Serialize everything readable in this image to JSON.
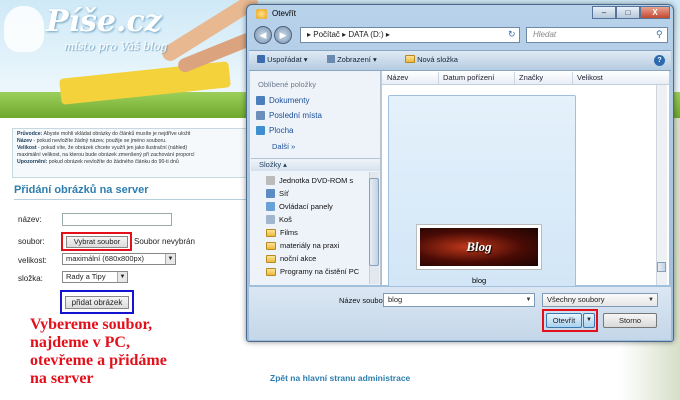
{
  "site": {
    "logo_text": "Píše.cz",
    "tagline": "místo pro Váš blog",
    "info_lines": [
      {
        "bold": "Průvodce:",
        "text": " Abyste mohli vkládat obrázky do článků musíte je nejdříve uložit"
      },
      {
        "bold": "Název",
        "text": " - pokud nevložíte žádný název, použije se jméno souboru."
      },
      {
        "bold": "Velikost",
        "text": " - pokud víte, že obrázek chcete využít jen jako ilustrační (náhled)"
      },
      {
        "bold": "",
        "text": "maximální velikost, na kterou bude obrázek zmenšený při zachování proporcí"
      },
      {
        "bold": "Upozornění:",
        "text": " pokud obrázek nevložíte do žádného článku do 90-ti dnů"
      }
    ],
    "section_title": "Přidání obrázků na server",
    "form": {
      "nazev_label": "název:",
      "nazev_value": "",
      "soubor_label": "soubor:",
      "pick_button": "Vybrat soubor",
      "no_file_text": "Soubor nevybrán",
      "velikost_label": "velikost:",
      "velikost_value": "maximální (680x800px)",
      "slozka_label": "složka:",
      "slozka_value": "Rady a Tipy",
      "submit_button": "přidat obrázek"
    },
    "annotation_lines": [
      "Vybereme soubor,",
      "najdeme v PC,",
      "otevřeme a přidáme",
      "na server"
    ],
    "back_link": "Zpět na hlavní stranu administrace"
  },
  "dialog": {
    "title": "Otevřít",
    "controls": {
      "minimize": "–",
      "maximize": "□",
      "close": "X"
    },
    "nav": {
      "back": "◀",
      "forward": "▶"
    },
    "address": "▸ Počítač ▸ DATA (D:) ▸",
    "search_placeholder": "Hledat",
    "toolbar": {
      "organize": "Uspořádat",
      "views": "Zobrazení",
      "new_folder": "Nová složka",
      "help": "?"
    },
    "favorites_header": "Oblíbené položky",
    "favorites": [
      {
        "label": "Dokumenty",
        "icon": "documents-icon",
        "color": "#4a7ebc"
      },
      {
        "label": "Poslední místa",
        "icon": "recent-places-icon",
        "color": "#6b8fb8"
      },
      {
        "label": "Plocha",
        "icon": "desktop-icon",
        "color": "#3f8fd0"
      }
    ],
    "more_label": "Další",
    "folders_header": "Složky",
    "tree": [
      {
        "label": "Jednotka DVD-ROM s",
        "icon": "dvd-drive-icon"
      },
      {
        "label": "Síť",
        "icon": "network-icon"
      },
      {
        "label": "Ovládací panely",
        "icon": "control-panel-icon"
      },
      {
        "label": "Koš",
        "icon": "recycle-bin-icon"
      },
      {
        "label": "Films",
        "icon": "folder-icon"
      },
      {
        "label": "materiály na praxi",
        "icon": "folder-icon"
      },
      {
        "label": "noční akce",
        "icon": "folder-icon"
      },
      {
        "label": "Programy na čistění PC",
        "icon": "folder-icon"
      }
    ],
    "columns": [
      "Název",
      "Datum pořízení",
      "Značky",
      "Velikost"
    ],
    "file": {
      "name": "blog",
      "thumbnail_text": "Blog"
    },
    "filename_label": "Název souboru:",
    "filename_value": "blog",
    "filetype_value": "Všechny soubory",
    "open_button": "Otevřít",
    "cancel_button": "Storno"
  },
  "colors": {
    "highlight_red": "#e3101c",
    "highlight_blue": "#1414d0",
    "link_blue": "#2d7eae"
  }
}
